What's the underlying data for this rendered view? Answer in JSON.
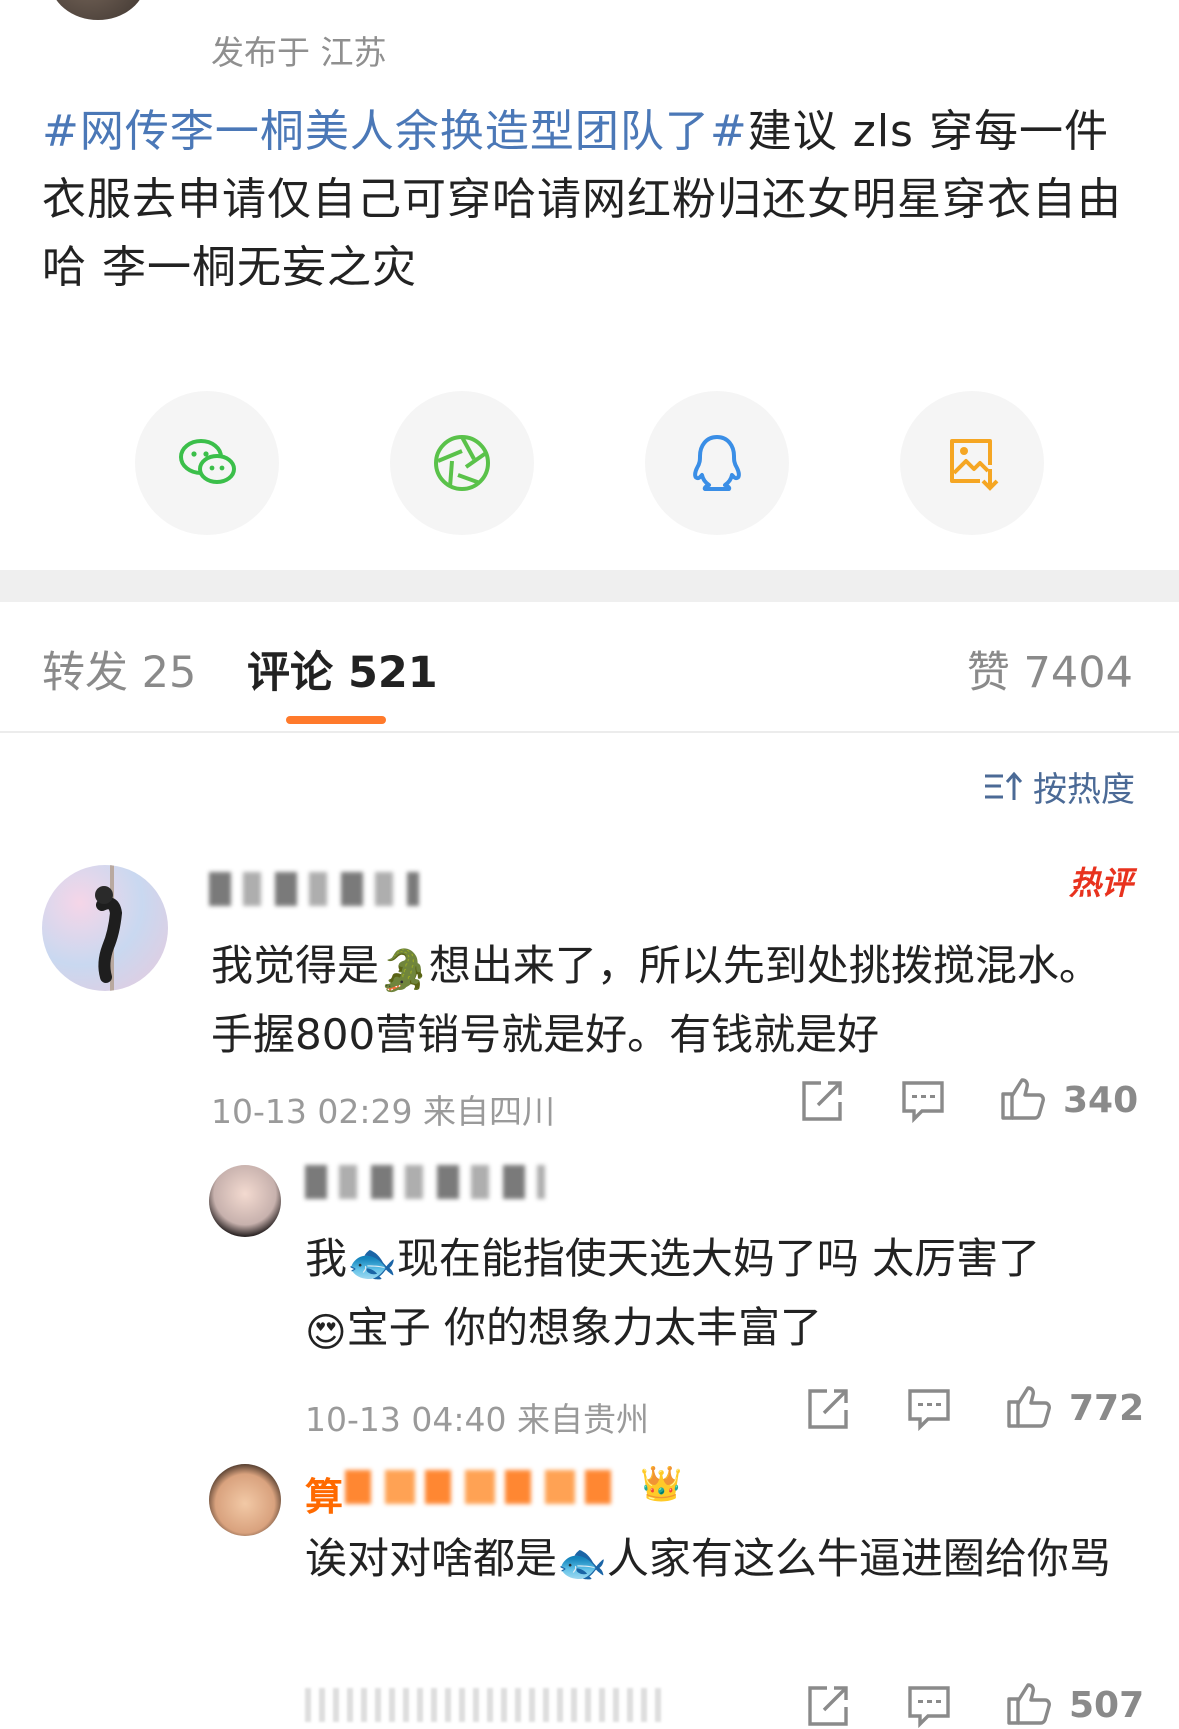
{
  "post": {
    "location": "发布于 江苏",
    "topic": "#网传李一桐美人余换造型团队了#",
    "text": "建议 zls 穿每一件衣服去申请仅自己可穿哈请网红粉归还女明星穿衣自由哈 李一桐无妄之灾"
  },
  "share": [
    {
      "icon": "wechat-icon",
      "color": "#3bbf4a"
    },
    {
      "icon": "moments-icon",
      "color": "#5ac24a"
    },
    {
      "icon": "qq-icon",
      "color": "#3a8ee6"
    },
    {
      "icon": "save-image-icon",
      "color": "#f5a623"
    }
  ],
  "tabs": {
    "repost": "转发 25",
    "comments": "评论 521",
    "likes": "赞 7404"
  },
  "sort_label": "按热度",
  "comments": [
    {
      "badge": "热评",
      "text_a": "我觉得是",
      "emoji_a": "🐊",
      "text_b": "想出来了，所以先到处挑拨搅混水。手握800营销号就是好。有钱就是好",
      "time": "10-13 02:29 来自四川",
      "likes": "340"
    },
    {
      "text_a": "我",
      "emoji_a": "🐟",
      "text_b": "现在能指使天选大妈了吗 太厉害了",
      "emoji_b": "😍",
      "text_c": "宝子 你的想象力太丰富了",
      "time": "10-13 04:40 来自贵州",
      "likes": "772"
    },
    {
      "name_prefix": "算",
      "text_a": "诶对对啥都是",
      "emoji_a": "🐟",
      "text_b": "人家有这么牛逼进圈给你骂",
      "likes": "507"
    }
  ]
}
